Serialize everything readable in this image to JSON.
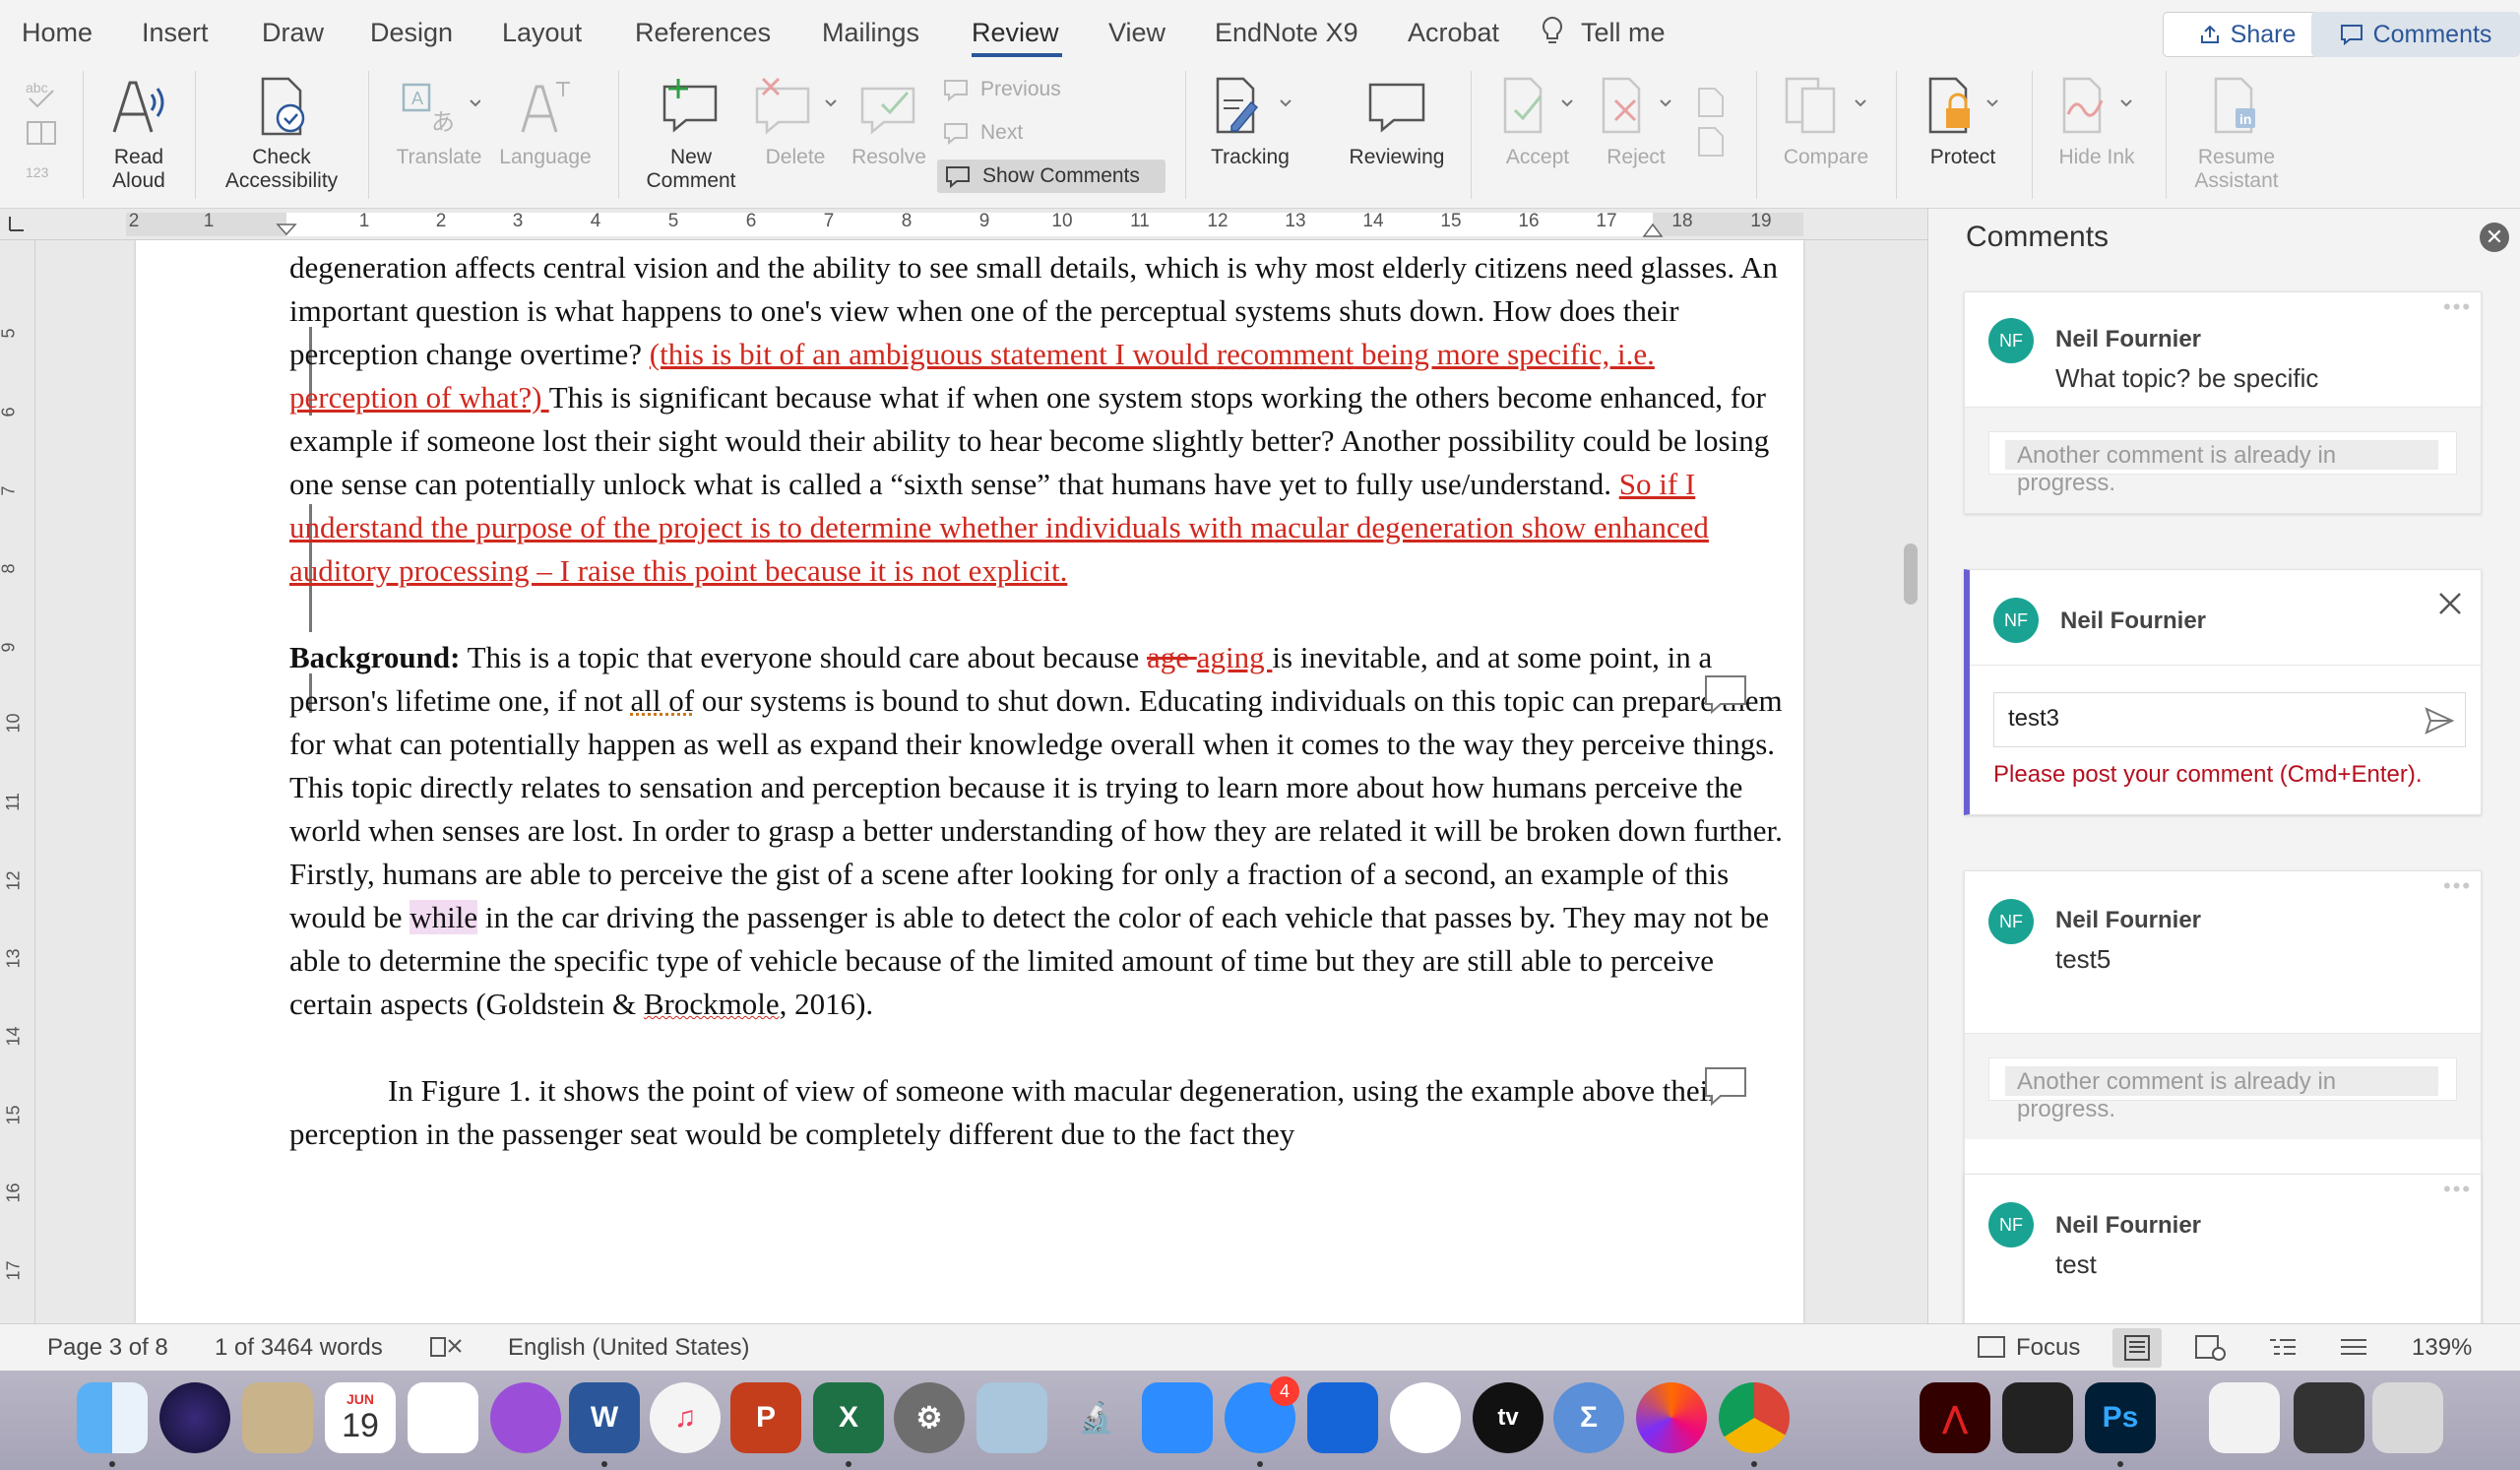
{
  "tabs": [
    "Home",
    "Insert",
    "Draw",
    "Design",
    "Layout",
    "References",
    "Mailings",
    "Review",
    "View",
    "EndNote X9",
    "Acrobat",
    "Tell me"
  ],
  "active_tab": "Review",
  "share_label": "Share",
  "comments_label": "Comments",
  "ribbon": {
    "read_aloud": [
      "Read",
      "Aloud"
    ],
    "check_accessibility": [
      "Check",
      "Accessibility"
    ],
    "translate": "Translate",
    "language": "Language",
    "new_comment": [
      "New",
      "Comment"
    ],
    "delete": "Delete",
    "resolve": "Resolve",
    "previous": "Previous",
    "next": "Next",
    "show_comments": "Show Comments",
    "tracking": "Tracking",
    "reviewing": "Reviewing",
    "accept": "Accept",
    "reject": "Reject",
    "compare": "Compare",
    "protect": "Protect",
    "hide_ink": "Hide Ink",
    "resume_assistant": [
      "Resume",
      "Assistant"
    ]
  },
  "ruler_h": [
    "2",
    "1",
    "1",
    "2",
    "3",
    "4",
    "5",
    "6",
    "7",
    "8",
    "9",
    "10",
    "11",
    "12",
    "13",
    "14",
    "15",
    "16",
    "17",
    "18",
    "19"
  ],
  "ruler_v": [
    "5",
    "6",
    "7",
    "8",
    "9",
    "10",
    "11",
    "12",
    "13",
    "14",
    "15",
    "16",
    "17"
  ],
  "document": {
    "p1_a": "degeneration affects central vision and the ability to see small details, which is why most elderly citizens need glasses. An important question is what happens to one's view when one of the perceptual systems shuts down. How does their perception change overtime? ",
    "p1_ins1a": "(this is bit of an ambiguous statement I would ",
    "p1_ins1b": "recomment",
    "p1_ins1c": " being more specific, i.e. perception of what?) ",
    "p1_b": "This is significant because what if when one system stops working the others become enhanced, for example if someone lost their sight would their ability to hear become slightly better? Another possibility could be losing one sense can potentially unlock what is called a “sixth sense” that humans have yet to fully use/understand. ",
    "p1_ins2": "So if I understand the purpose of the project is to determine whether individuals with macular degeneration show enhanced auditory processing – I raise this point because it is not explicit.",
    "p2_bold": "Background:",
    "p2_a": " This is a topic that everyone should care about because ",
    "p2_del": "age ",
    "p2_ins": "aging ",
    "p2_b": "is inevitable, and at some point, in a person's lifetime one, if not ",
    "p2_dotted": "all of",
    "p2_c": " our systems is bound to shut down. Educating individuals on this topic can prepare them for what can potentially happen as well as expand their knowledge overall when it comes to the way they perceive things. This topic directly relates to sensation and perception because it is trying to learn more about how humans perceive the world when senses are lost. In order to grasp a better understanding of how they are related it will be broken down further. Firstly, humans are able to perceive the gist of a scene after looking for only a fraction of a second, an example of this would be ",
    "p2_hl": "while",
    "p2_d": " in the car driving the passenger is able to detect the color of each vehicle that passes by. They may not be able to determine the specific type of vehicle because of the limited amount of time but they are still able to perceive certain aspects (Goldstein & ",
    "p2_sq": "Brockmole",
    "p2_e": ", 2016).",
    "p3": "In Figure 1. it shows the point of view of someone with macular degeneration, using the example above their perception in the passenger seat would be completely different due to the fact they"
  },
  "comments_pane": {
    "title": "Comments",
    "cards": [
      {
        "initials": "NF",
        "author": "Neil Fournier",
        "text": "What topic? be specific",
        "reply_placeholder": "Another comment is already in progress."
      },
      {
        "initials": "NF",
        "author": "Neil Fournier",
        "draft": "test3",
        "error": "Please post your comment (Cmd+Enter)."
      },
      {
        "initials": "NF",
        "author": "Neil Fournier",
        "text": "test5",
        "reply_placeholder": "Another comment is already in progress."
      },
      {
        "initials": "NF",
        "author": "Neil Fournier",
        "text": "test"
      }
    ]
  },
  "status": {
    "page": "Page 3 of 8",
    "words": "1 of 3464 words",
    "language": "English (United States)",
    "focus": "Focus",
    "zoom": "139%"
  },
  "dock": {
    "calendar_month": "JUN",
    "calendar_day": "19",
    "messages_badge": "4",
    "word_letter": "W",
    "powerpoint_letter": "P",
    "excel_letter": "X",
    "photoshop_letters": "Ps",
    "appletv_label": "tv"
  },
  "colors": {
    "revision": "#d0281e",
    "accent": "#2b579a",
    "avatar": "#1aa393",
    "active_comment": "#6a5fd2",
    "error": "#b5101f"
  }
}
